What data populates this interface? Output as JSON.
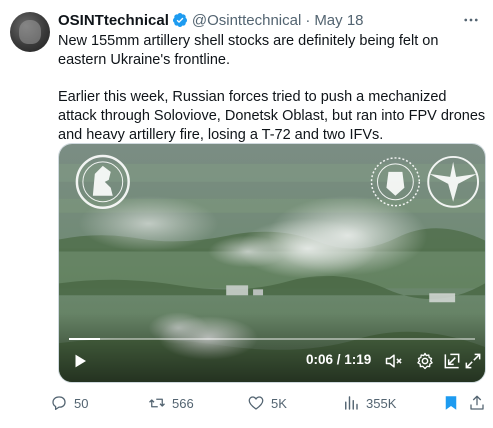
{
  "tweet": {
    "author_name": "OSINTtechnical",
    "handle": "@Osinttechnical",
    "separator": "·",
    "date": "May 18",
    "paragraphs": [
      "New 155mm artillery shell stocks are definitely being felt on eastern Ukraine's frontline.",
      "Earlier this week, Russian forces tried to push a mechanized attack through Soloviove, Donetsk Oblast, but ran into FPV drones and heavy artillery fire, losing a T-72 and two IFVs."
    ]
  },
  "video": {
    "time_display": "0:06 / 1:19",
    "progress": 0.076
  },
  "actions": {
    "replies": "50",
    "reposts": "566",
    "likes": "5K",
    "views": "355K"
  },
  "icons": {
    "verified": "verified-badge-icon",
    "more": "more-options-icon",
    "reply": "reply-icon",
    "repost": "repost-icon",
    "like": "heart-icon",
    "views": "views-chart-icon",
    "bookmark": "bookmark-icon",
    "share": "share-icon",
    "play": "play-icon",
    "mute": "mute-icon",
    "settings": "settings-gear-icon",
    "pip": "picture-in-picture-icon",
    "fullscreen": "fullscreen-icon"
  },
  "colors": {
    "accent": "#1d9bf0",
    "text_primary": "#0f1419",
    "text_secondary": "#536471"
  }
}
